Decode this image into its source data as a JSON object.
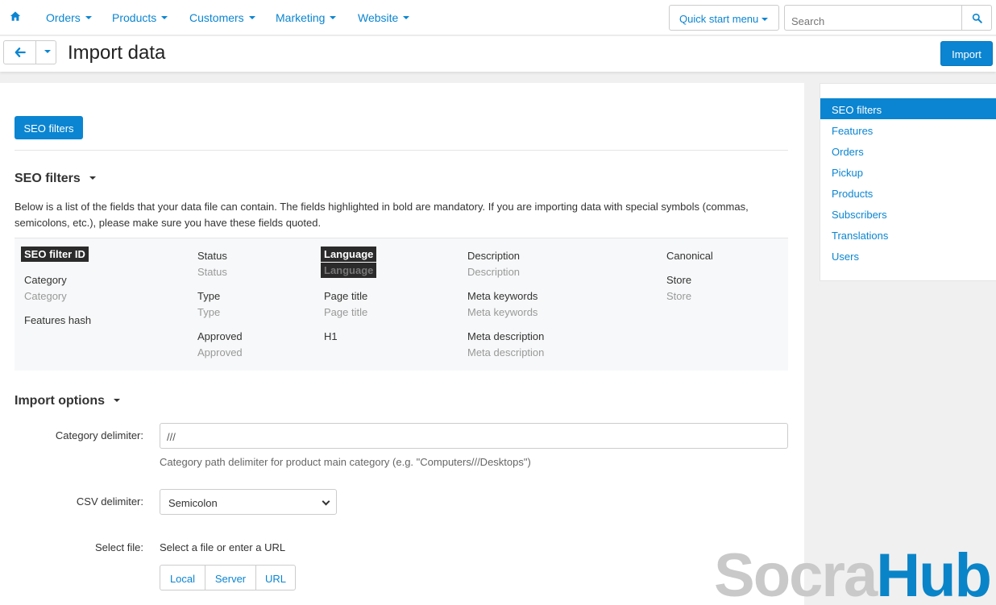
{
  "topnav": {
    "menus": [
      "Orders",
      "Products",
      "Customers",
      "Marketing",
      "Website"
    ],
    "quick_start": "Quick start menu",
    "search_placeholder": "Search"
  },
  "toolbar": {
    "title": "Import data",
    "import_label": "Import"
  },
  "sidebar": {
    "items": [
      "SEO filters",
      "Features",
      "Orders",
      "Pickup",
      "Products",
      "Subscribers",
      "Translations",
      "Users"
    ]
  },
  "main": {
    "tab_label": "SEO filters",
    "section_title": "SEO filters",
    "description": "Below is a list of the fields that your data file can contain. The fields highlighted in bold are mandatory. If you are importing data with special symbols (commas, semicolons, etc.), please make sure you have these fields quoted.",
    "fields": {
      "seo_filter_id": "SEO filter ID",
      "category": "Category",
      "category_hint": "Category",
      "features_hash": "Features hash",
      "status": "Status",
      "status_hint": "Status",
      "type": "Type",
      "type_hint": "Type",
      "approved": "Approved",
      "approved_hint": "Approved",
      "language": "Language",
      "language_hint": "Language",
      "page_title": "Page title",
      "page_title_hint": "Page title",
      "h1": "H1",
      "description": "Description",
      "description_hint": "Description",
      "meta_keywords": "Meta keywords",
      "meta_keywords_hint": "Meta keywords",
      "meta_description": "Meta description",
      "meta_description_hint": "Meta description",
      "canonical": "Canonical",
      "store": "Store",
      "store_hint": "Store"
    },
    "import_options": {
      "title": "Import options",
      "category_delimiter_label": "Category delimiter:",
      "category_delimiter_value": "///",
      "category_delimiter_help": "Category path delimiter for product main category (e.g. \"Computers///Desktops\")",
      "csv_delimiter_label": "CSV delimiter:",
      "csv_delimiter_value": "Semicolon",
      "select_file_label": "Select file:",
      "select_file_hint": "Select a file or enter a URL",
      "file_sources": [
        "Local",
        "Server",
        "URL"
      ]
    }
  },
  "watermark": {
    "part1": "Socra",
    "part2": "Hub"
  },
  "colors": {
    "accent": "#0b85d1"
  }
}
